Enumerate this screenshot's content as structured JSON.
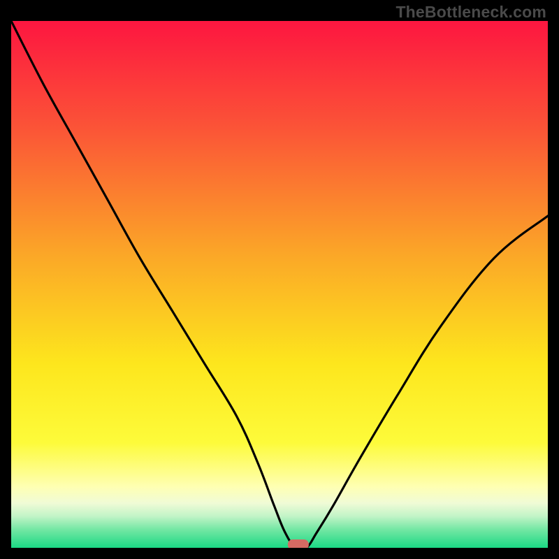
{
  "watermark": "TheBottleneck.com",
  "colors": {
    "background": "#000000",
    "watermark": "#4a4a4a",
    "curve": "#000000",
    "marker_fill": "#d66a63",
    "gradient_stops": [
      {
        "offset": 0.0,
        "color": "#fd1640"
      },
      {
        "offset": 0.2,
        "color": "#fb5337"
      },
      {
        "offset": 0.45,
        "color": "#fba927"
      },
      {
        "offset": 0.65,
        "color": "#fde61d"
      },
      {
        "offset": 0.8,
        "color": "#fdfb3a"
      },
      {
        "offset": 0.885,
        "color": "#feffb4"
      },
      {
        "offset": 0.915,
        "color": "#f0fbd6"
      },
      {
        "offset": 0.94,
        "color": "#c2f4c7"
      },
      {
        "offset": 0.965,
        "color": "#74e7a4"
      },
      {
        "offset": 1.0,
        "color": "#1bd884"
      }
    ]
  },
  "chart_data": {
    "type": "line",
    "title": "",
    "xlabel": "",
    "ylabel": "",
    "xlim": [
      0,
      100
    ],
    "ylim": [
      0,
      100
    ],
    "grid": false,
    "legend": false,
    "series": [
      {
        "name": "bottleneck-curve",
        "x": [
          0,
          6,
          12,
          18,
          24,
          30,
          36,
          42,
          46,
          49,
          51,
          53,
          55,
          57,
          60,
          65,
          72,
          80,
          90,
          100
        ],
        "values": [
          100,
          88,
          77,
          66,
          55,
          45,
          35,
          25,
          16,
          8,
          3,
          0,
          0,
          3,
          8,
          17,
          29,
          42,
          55,
          63
        ]
      }
    ],
    "annotations": [
      {
        "type": "marker",
        "shape": "rounded-rect",
        "x": 53.5,
        "y": 0,
        "label": "optimal-point"
      }
    ]
  }
}
